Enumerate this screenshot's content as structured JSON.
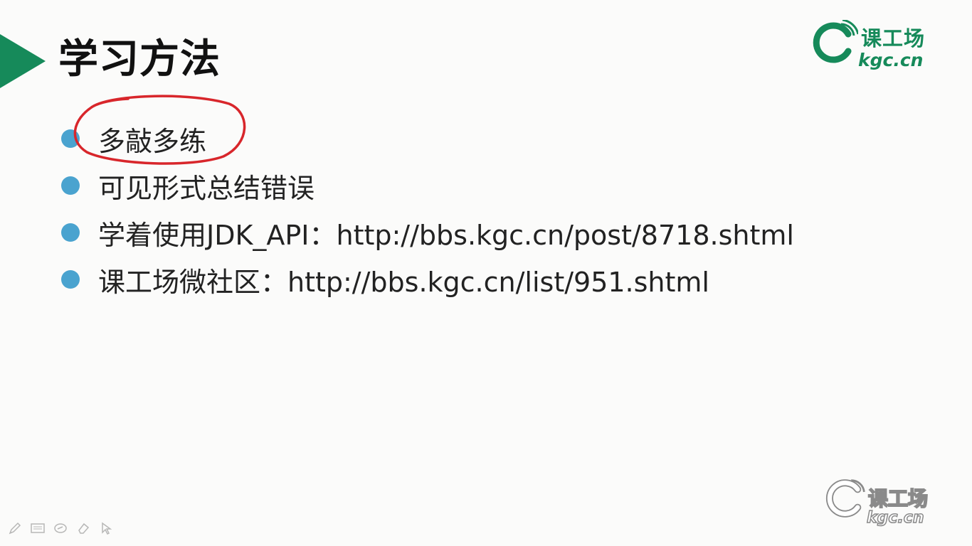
{
  "slide": {
    "title": "学习方法",
    "accent_color": "#168a5a",
    "bullet_color": "#4aa3cf",
    "annotation_color": "#d8262b",
    "bullets": [
      {
        "text": "多敲多练"
      },
      {
        "text": "可见形式总结错误"
      },
      {
        "text": "学着使用JDK_API：http://bbs.kgc.cn/post/8718.shtml"
      },
      {
        "text": "课工场微社区：http://bbs.kgc.cn/list/951.shtml"
      }
    ]
  },
  "logo": {
    "name": "课工场",
    "domain": "kgc.cn",
    "icon": "kgc-logo-icon"
  },
  "watermark": {
    "name": "课工场",
    "domain": "kgc.cn"
  },
  "toolbar": {
    "tools": [
      {
        "icon": "pen-icon"
      },
      {
        "icon": "slides-icon"
      },
      {
        "icon": "ink-icon"
      },
      {
        "icon": "eraser-icon"
      },
      {
        "icon": "pointer-icon"
      }
    ]
  }
}
